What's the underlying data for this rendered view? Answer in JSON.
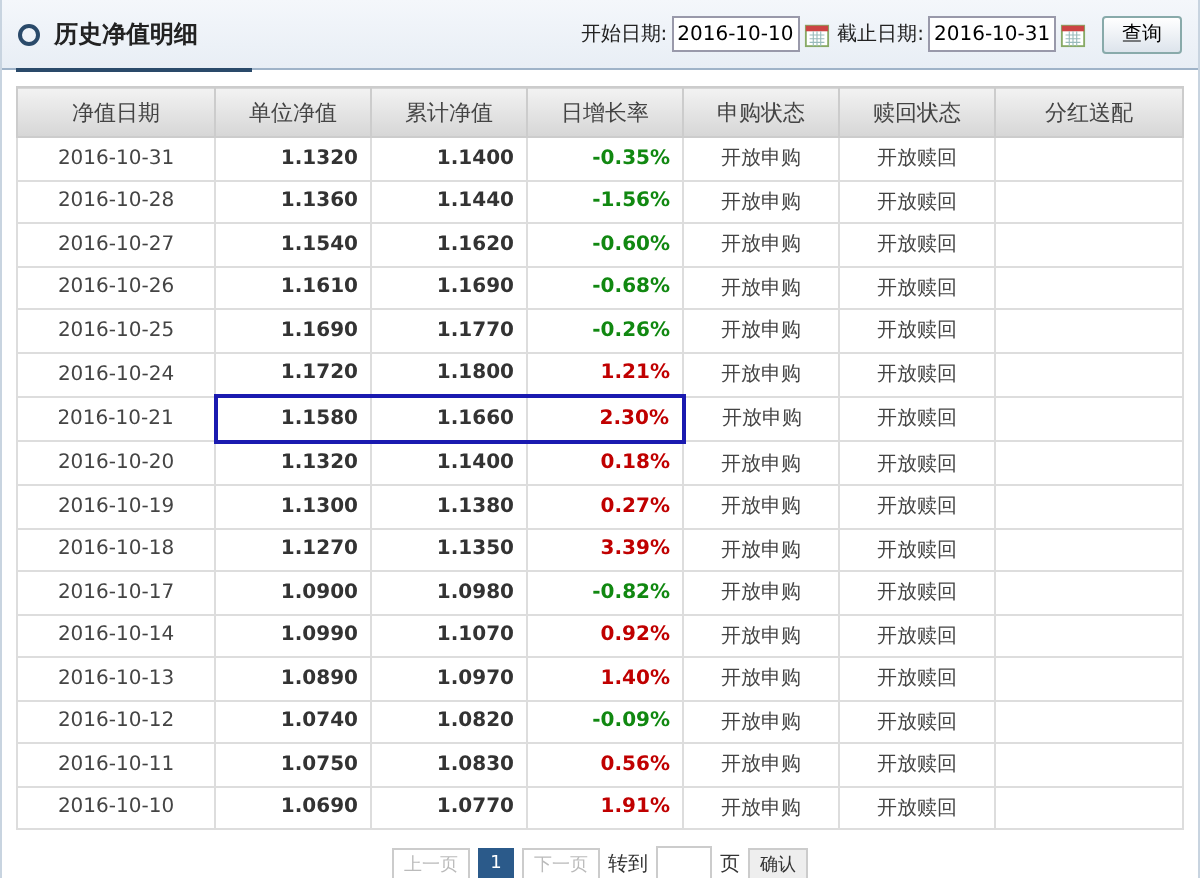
{
  "title": "历史净值明细",
  "filter": {
    "start_label": "开始日期:",
    "start_value": "2016-10-10",
    "end_label": "截止日期:",
    "end_value": "2016-10-31",
    "button": "查询"
  },
  "columns": [
    "净值日期",
    "单位净值",
    "累计净值",
    "日增长率",
    "申购状态",
    "赎回状态",
    "分红送配"
  ],
  "rows": [
    {
      "date": "2016-10-31",
      "nav": "1.1320",
      "acc": "1.1400",
      "rate": "-0.35%",
      "color": "#118811",
      "buy": "开放申购",
      "redeem": "开放赎回",
      "highlighted": false
    },
    {
      "date": "2016-10-28",
      "nav": "1.1360",
      "acc": "1.1440",
      "rate": "-1.56%",
      "color": "#118811",
      "buy": "开放申购",
      "redeem": "开放赎回",
      "highlighted": false
    },
    {
      "date": "2016-10-27",
      "nav": "1.1540",
      "acc": "1.1620",
      "rate": "-0.60%",
      "color": "#118811",
      "buy": "开放申购",
      "redeem": "开放赎回",
      "highlighted": false
    },
    {
      "date": "2016-10-26",
      "nav": "1.1610",
      "acc": "1.1690",
      "rate": "-0.68%",
      "color": "#118811",
      "buy": "开放申购",
      "redeem": "开放赎回",
      "highlighted": false
    },
    {
      "date": "2016-10-25",
      "nav": "1.1690",
      "acc": "1.1770",
      "rate": "-0.26%",
      "color": "#118811",
      "buy": "开放申购",
      "redeem": "开放赎回",
      "highlighted": false
    },
    {
      "date": "2016-10-24",
      "nav": "1.1720",
      "acc": "1.1800",
      "rate": "1.21%",
      "color": "#c00000",
      "buy": "开放申购",
      "redeem": "开放赎回",
      "highlighted": false
    },
    {
      "date": "2016-10-21",
      "nav": "1.1580",
      "acc": "1.1660",
      "rate": "2.30%",
      "color": "#c00000",
      "buy": "开放申购",
      "redeem": "开放赎回",
      "highlighted": true
    },
    {
      "date": "2016-10-20",
      "nav": "1.1320",
      "acc": "1.1400",
      "rate": "0.18%",
      "color": "#c00000",
      "buy": "开放申购",
      "redeem": "开放赎回",
      "highlighted": false
    },
    {
      "date": "2016-10-19",
      "nav": "1.1300",
      "acc": "1.1380",
      "rate": "0.27%",
      "color": "#c00000",
      "buy": "开放申购",
      "redeem": "开放赎回",
      "highlighted": false
    },
    {
      "date": "2016-10-18",
      "nav": "1.1270",
      "acc": "1.1350",
      "rate": "3.39%",
      "color": "#c00000",
      "buy": "开放申购",
      "redeem": "开放赎回",
      "highlighted": false
    },
    {
      "date": "2016-10-17",
      "nav": "1.0900",
      "acc": "1.0980",
      "rate": "-0.82%",
      "color": "#118811",
      "buy": "开放申购",
      "redeem": "开放赎回",
      "highlighted": false
    },
    {
      "date": "2016-10-14",
      "nav": "1.0990",
      "acc": "1.1070",
      "rate": "0.92%",
      "color": "#c00000",
      "buy": "开放申购",
      "redeem": "开放赎回",
      "highlighted": false
    },
    {
      "date": "2016-10-13",
      "nav": "1.0890",
      "acc": "1.0970",
      "rate": "1.40%",
      "color": "#c00000",
      "buy": "开放申购",
      "redeem": "开放赎回",
      "highlighted": false
    },
    {
      "date": "2016-10-12",
      "nav": "1.0740",
      "acc": "1.0820",
      "rate": "-0.09%",
      "color": "#118811",
      "buy": "开放申购",
      "redeem": "开放赎回",
      "highlighted": false
    },
    {
      "date": "2016-10-11",
      "nav": "1.0750",
      "acc": "1.0830",
      "rate": "0.56%",
      "color": "#c00000",
      "buy": "开放申购",
      "redeem": "开放赎回",
      "highlighted": false
    },
    {
      "date": "2016-10-10",
      "nav": "1.0690",
      "acc": "1.0770",
      "rate": "1.91%",
      "color": "#c00000",
      "buy": "开放申购",
      "redeem": "开放赎回",
      "highlighted": false
    }
  ],
  "pagination": {
    "prev": {
      "label": "上一页",
      "disabled": true
    },
    "pages": [
      {
        "label": "1",
        "selected": true
      }
    ],
    "next": {
      "label": "下一页",
      "disabled": true
    },
    "goto_label": "转到",
    "page_unit": "页",
    "confirm": "确认"
  }
}
